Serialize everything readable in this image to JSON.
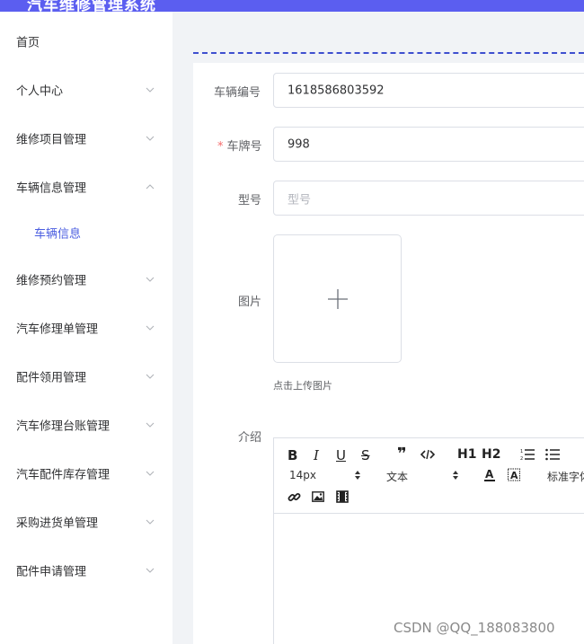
{
  "app": {
    "title": "汽车维修管理系统"
  },
  "sidebar": {
    "items": [
      {
        "label": "首页",
        "expandable": false
      },
      {
        "label": "个人中心",
        "expandable": true,
        "expanded": false
      },
      {
        "label": "维修项目管理",
        "expandable": true,
        "expanded": false
      },
      {
        "label": "车辆信息管理",
        "expandable": true,
        "expanded": true
      },
      {
        "label": "车辆信息",
        "submenu": true,
        "active": true
      },
      {
        "label": "维修预约管理",
        "expandable": true,
        "expanded": false
      },
      {
        "label": "汽车修理单管理",
        "expandable": true,
        "expanded": false
      },
      {
        "label": "配件领用管理",
        "expandable": true,
        "expanded": false
      },
      {
        "label": "汽车修理台账管理",
        "expandable": true,
        "expanded": false
      },
      {
        "label": "汽车配件库存管理",
        "expandable": true,
        "expanded": false
      },
      {
        "label": "采购进货单管理",
        "expandable": true,
        "expanded": false
      },
      {
        "label": "配件申请管理",
        "expandable": true,
        "expanded": false
      }
    ]
  },
  "form": {
    "vehicle_no": {
      "label": "车辆编号",
      "value": "1618586803592"
    },
    "plate": {
      "label": "车牌号",
      "required_mark": "*",
      "value": "998"
    },
    "model": {
      "label": "型号",
      "placeholder": "型号",
      "value": ""
    },
    "image": {
      "label": "图片",
      "upload_tip": "点击上传图片",
      "icon": "plus-icon"
    },
    "intro": {
      "label": "介绍"
    }
  },
  "editor": {
    "toolbar_row1": [
      "B",
      "I",
      "U",
      "S",
      "quote",
      "code",
      "H1",
      "H2",
      "ordered-list",
      "bullet-list"
    ],
    "font_size": "14px",
    "block_format": "文本",
    "font_family": "标准字体",
    "toolbar_row3": [
      "link",
      "image",
      "video"
    ]
  },
  "watermark": "CSDN @QQ_188083800",
  "colors": {
    "accent": "#5b5ef0",
    "submenu_active": "#4a5de0",
    "required": "#f56c6c",
    "border": "#dcdfe6"
  }
}
